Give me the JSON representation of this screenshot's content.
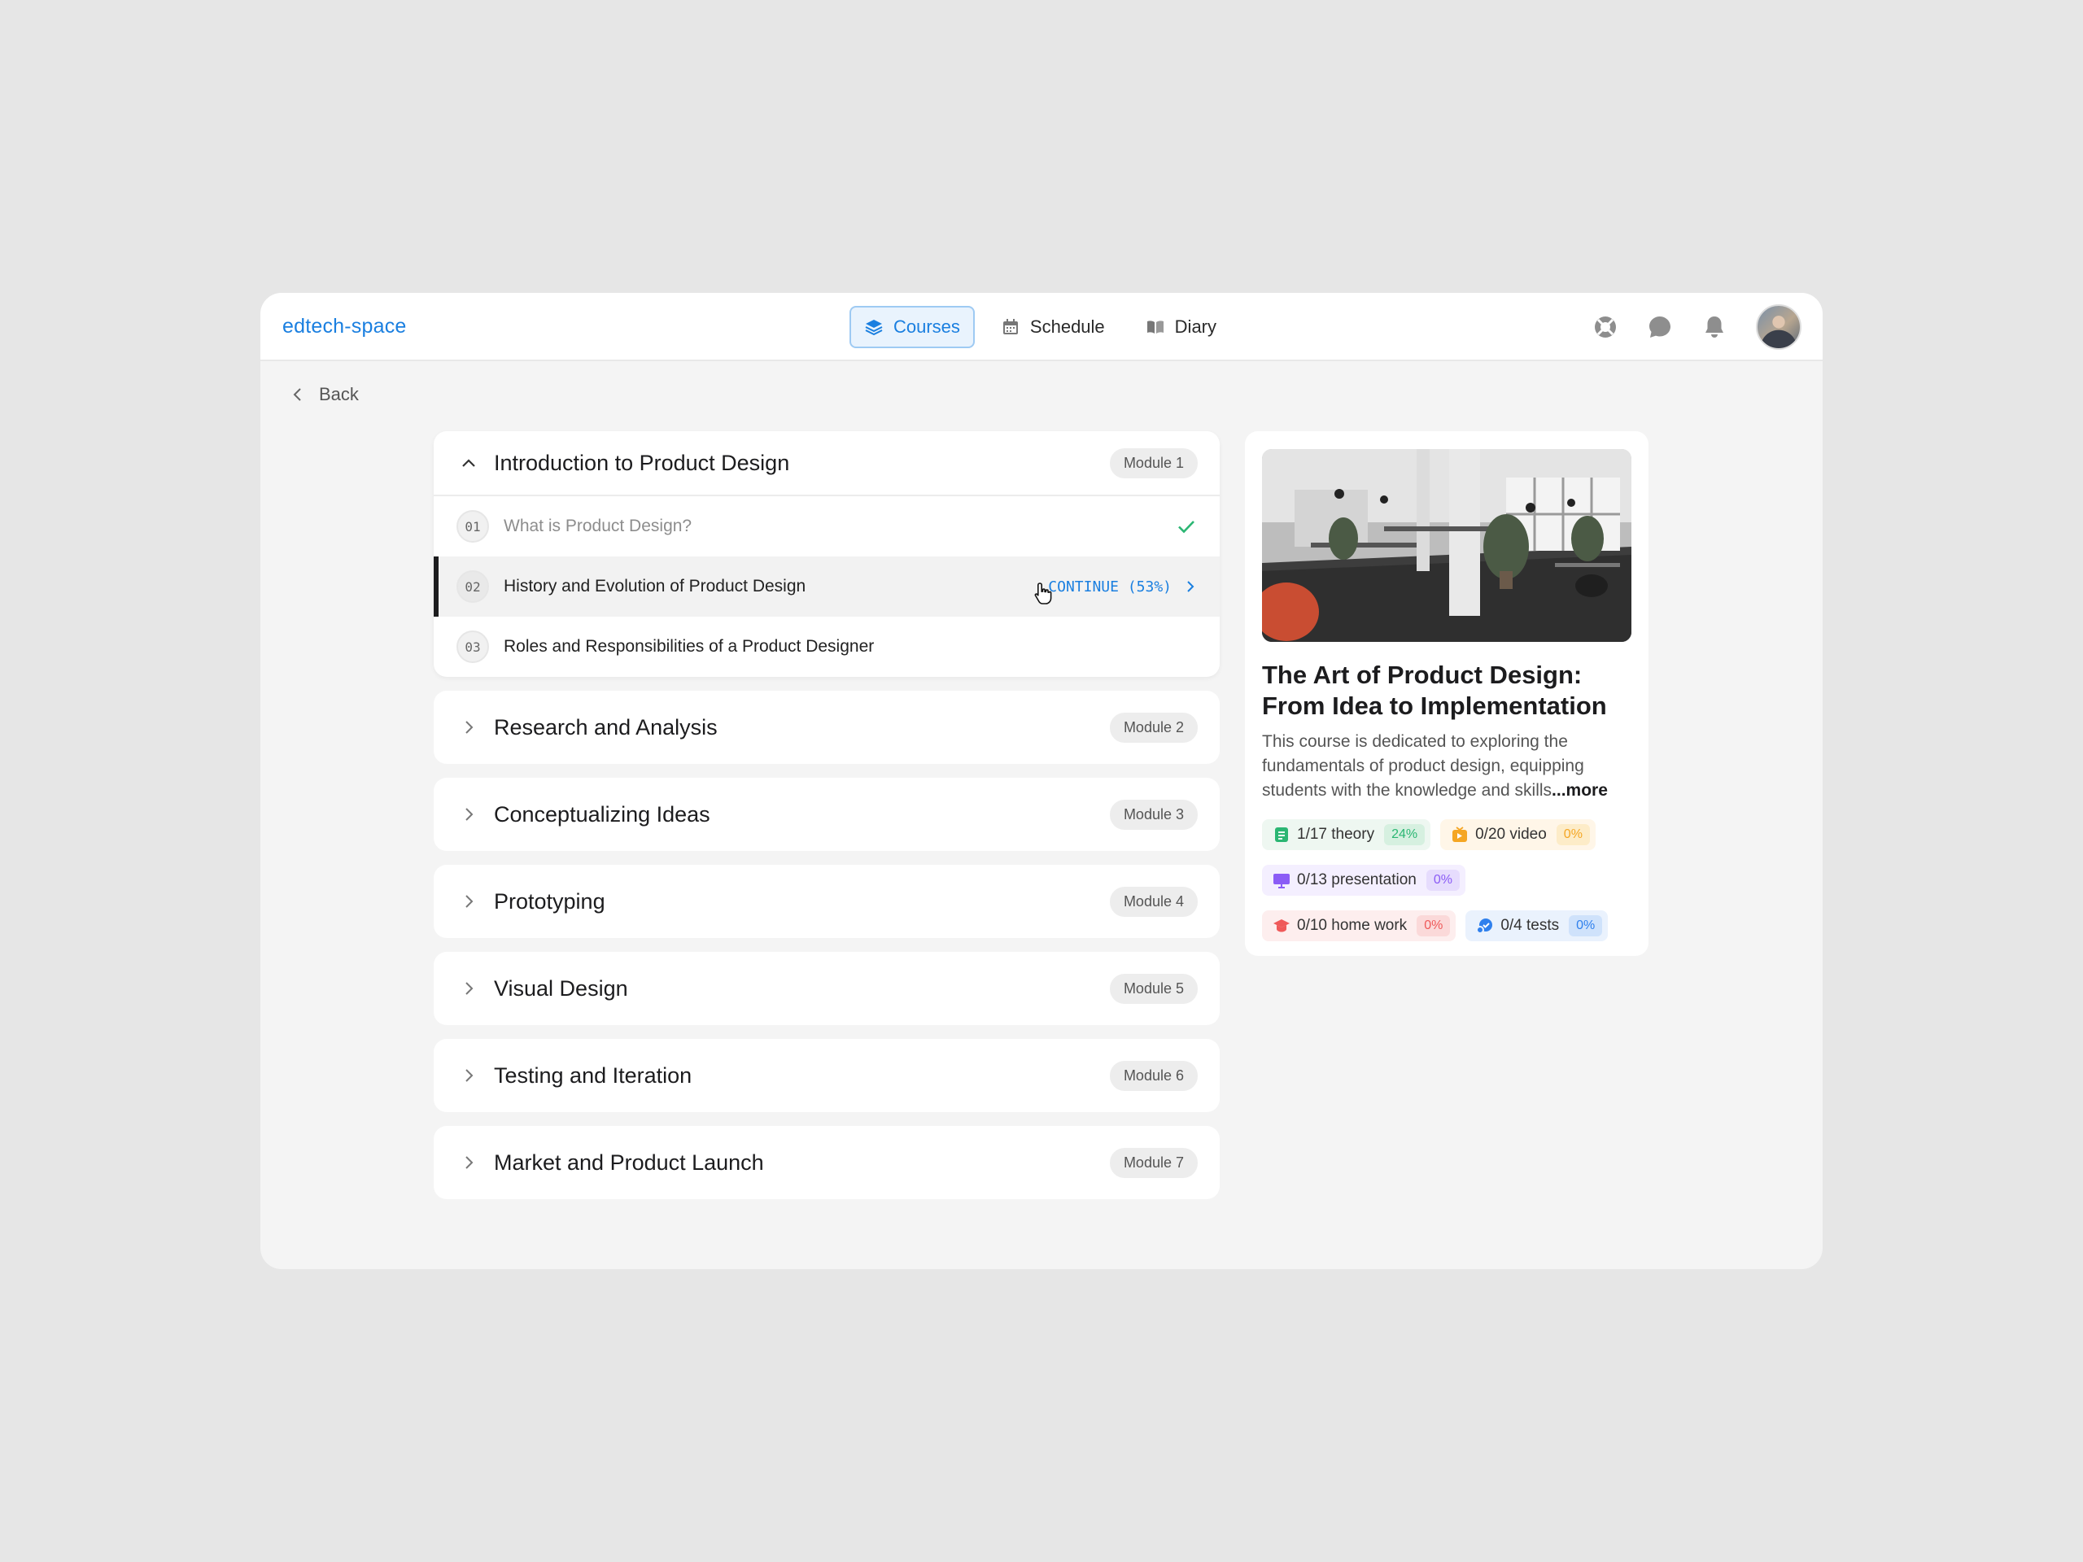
{
  "brand": "edtech-space",
  "nav": {
    "courses": "Courses",
    "schedule": "Schedule",
    "diary": "Diary"
  },
  "back_label": "Back",
  "modules": [
    {
      "title": "Introduction to Product Design",
      "badge": "Module 1",
      "lessons": [
        {
          "num": "01",
          "title": "What is Product Design?"
        },
        {
          "num": "02",
          "title": "History and Evolution of Product Design",
          "continue": "CONTINUE (53%)"
        },
        {
          "num": "03",
          "title": "Roles and Responsibilities of a Product Designer"
        }
      ]
    },
    {
      "title": "Research and Analysis",
      "badge": "Module 2"
    },
    {
      "title": "Conceptualizing Ideas",
      "badge": "Module 3"
    },
    {
      "title": "Prototyping",
      "badge": "Module 4"
    },
    {
      "title": "Visual Design",
      "badge": "Module 5"
    },
    {
      "title": "Testing and Iteration",
      "badge": "Module 6"
    },
    {
      "title": "Market and Product Launch",
      "badge": "Module 7"
    }
  ],
  "course": {
    "title": "The Art of Product Design: From Idea to Implementation",
    "description": "This course is dedicated to exploring the fundamentals of product design, equipping students with the knowledge and skills",
    "more": "...more",
    "stats": {
      "theory": {
        "label": "1/17 theory",
        "pct": "24%",
        "progress": 0.24
      },
      "video": {
        "label": "0/20 video",
        "pct": "0%",
        "progress": 0
      },
      "presentation": {
        "label": "0/13 presentation",
        "pct": "0%",
        "progress": 0
      },
      "homework": {
        "label": "0/10 home work",
        "pct": "0%",
        "progress": 0
      },
      "tests": {
        "label": "0/4 tests",
        "pct": "0%",
        "progress": 0
      }
    }
  },
  "colors": {
    "accent": "#1a7fe0",
    "theory": "#2bb673",
    "video": "#f5a623",
    "presentation": "#8b5cf6",
    "homework": "#ef5a5a",
    "tests": "#2f80ed"
  },
  "icons": [
    "courses-icon",
    "calendar-icon",
    "book-icon",
    "lifebuoy-icon",
    "chat-icon",
    "bell-icon",
    "chevron-left-icon",
    "chevron-up-icon",
    "chevron-right-icon",
    "check-icon",
    "hand-cursor-icon"
  ]
}
